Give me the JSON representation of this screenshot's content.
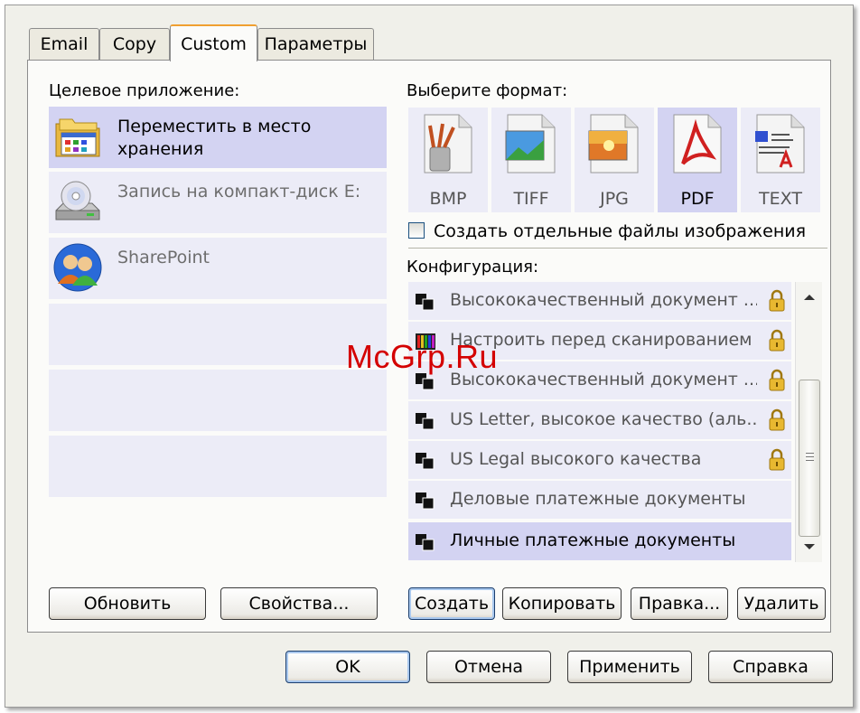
{
  "tabs": [
    {
      "label": "Email",
      "active": false
    },
    {
      "label": "Copy",
      "active": false
    },
    {
      "label": "Custom",
      "active": true
    },
    {
      "label": "Параметры",
      "active": false
    }
  ],
  "target": {
    "label": "Целевое приложение:",
    "apps": [
      {
        "name": "Переместить в место хранения",
        "icon": "folder-storage-icon",
        "selected": true
      },
      {
        "name": "Запись на компакт-диск  E:",
        "icon": "cd-drive-icon",
        "selected": false
      },
      {
        "name": "SharePoint",
        "icon": "sharepoint-users-icon",
        "selected": false
      }
    ]
  },
  "format": {
    "label": "Выберите формат:",
    "items": [
      {
        "label": "BMP",
        "icon": "bmp-file-icon",
        "selected": false
      },
      {
        "label": "TIFF",
        "icon": "tiff-file-icon",
        "selected": false
      },
      {
        "label": "JPG",
        "icon": "jpg-file-icon",
        "selected": false
      },
      {
        "label": "PDF",
        "icon": "pdf-file-icon",
        "selected": true
      },
      {
        "label": "TEXT",
        "icon": "text-file-icon",
        "selected": false
      }
    ],
    "separate_files_label": "Создать отдельные файлы изображения",
    "separate_files_checked": false
  },
  "config": {
    "label": "Конфигурация:",
    "items": [
      {
        "label": "Высококачественный документ ...",
        "icon": "scan-config-icon",
        "locked": true,
        "selected": false
      },
      {
        "label": "Настроить перед сканированием",
        "icon": "color-config-icon",
        "locked": true,
        "selected": false
      },
      {
        "label": "Высококачественный документ ...",
        "icon": "scan-config-icon",
        "locked": true,
        "selected": false
      },
      {
        "label": "US Letter, высокое качество (аль...",
        "icon": "scan-config-icon",
        "locked": true,
        "selected": false
      },
      {
        "label": "US Legal высокого качества",
        "icon": "scan-config-icon",
        "locked": true,
        "selected": false
      },
      {
        "label": "Деловые платежные документы",
        "icon": "scan-config-icon",
        "locked": false,
        "selected": false
      },
      {
        "label": "Личные платежные документы",
        "icon": "scan-config-icon",
        "locked": false,
        "selected": true
      }
    ]
  },
  "left_buttons": {
    "refresh": "Обновить",
    "properties": "Свойства..."
  },
  "config_buttons": {
    "create": "Создать",
    "copy": "Копировать",
    "edit": "Правка...",
    "delete": "Удалить"
  },
  "dialog_buttons": {
    "ok": "OK",
    "cancel": "Отмена",
    "apply": "Применить",
    "help": "Справка"
  },
  "watermark": "McGrp.Ru",
  "colors": {
    "selected_row": "#d3d3f2",
    "row": "#ececf7",
    "lock": "#e0b020",
    "pdf_red": "#d02020"
  }
}
